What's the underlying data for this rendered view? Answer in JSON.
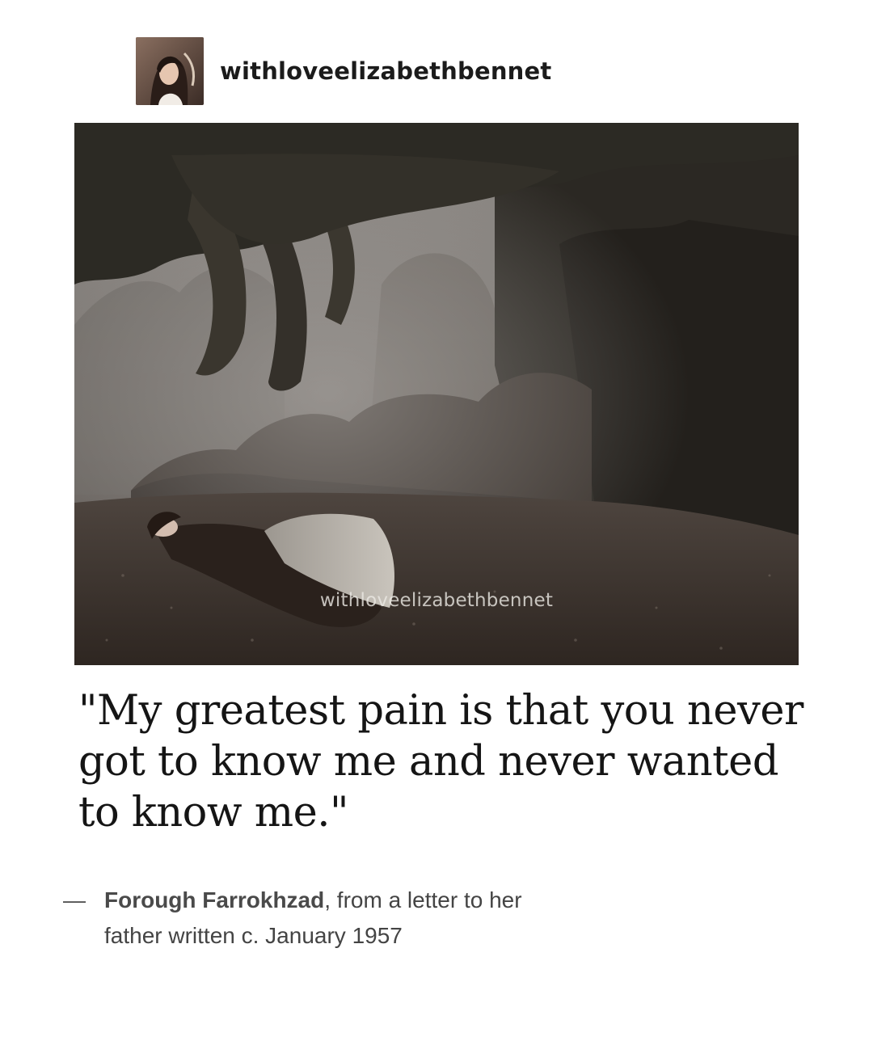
{
  "post": {
    "username": "withloveelizabethbennet",
    "avatar_icon": "profile-photo-woman",
    "photo": {
      "description_icon": "misty-forest-woman-lying-on-grass",
      "watermark": "withloveelizabethbennet"
    },
    "quote": "\"My greatest pain is that you never got to know me and never wanted to know me.\"",
    "attribution": {
      "dash": "—",
      "author": "Forough Farrokhzad",
      "line1_rest": ", from a letter to her",
      "line2": "father written c. January 1957"
    }
  },
  "colors": {
    "background": "#ffffff",
    "text": "#151515",
    "attribution_text": "#444444"
  }
}
